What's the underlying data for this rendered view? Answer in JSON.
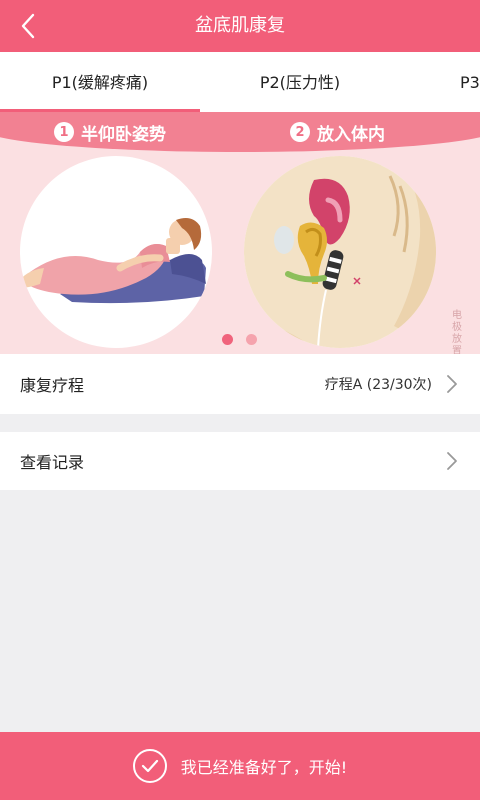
{
  "header": {
    "title": "盆底肌康复",
    "back_icon": "chevron-left-icon"
  },
  "tabs": [
    {
      "label": "P1(缓解疼痛)",
      "active": true
    },
    {
      "label": "P2(压力性)",
      "active": false
    },
    {
      "label": "P3",
      "active": false
    }
  ],
  "banner": {
    "steps": [
      {
        "number": "1",
        "label": "半仰卧姿势"
      },
      {
        "number": "2",
        "label": "放入体内"
      }
    ],
    "side_note": "电极放置示意图",
    "page_dots": {
      "count": 2,
      "active_index": 0
    },
    "colors": {
      "band": "#f28192",
      "background": "#fbe0e2",
      "dot_active": "#f0637c",
      "dot_inactive": "#f5a3ad"
    }
  },
  "list": {
    "items": [
      {
        "label": "康复疗程",
        "value": "疗程A (23/30次)",
        "icon": "chevron-right-icon"
      },
      {
        "label": "查看记录",
        "value": "",
        "icon": "chevron-right-icon"
      }
    ]
  },
  "footer": {
    "label": "我已经准备好了，开始!",
    "icon": "check-circle-icon"
  },
  "colors": {
    "accent": "#f25e79",
    "page_background": "#efeff1"
  }
}
